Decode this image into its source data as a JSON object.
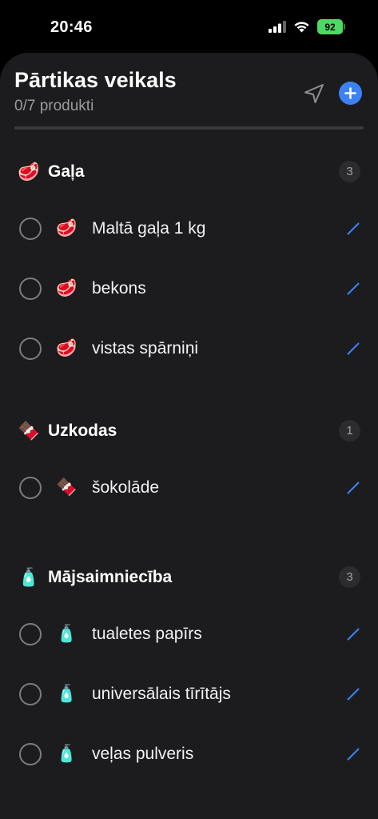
{
  "status_bar": {
    "time": "20:46",
    "battery": "92"
  },
  "header": {
    "title": "Pārtikas veikals",
    "subtitle": "0/7 produkti",
    "progress": 0,
    "accent_color": "#3b82f6"
  },
  "sections": [
    {
      "emoji": "🥩",
      "title": "Gaļa",
      "count": "3",
      "items": [
        {
          "emoji": "🥩",
          "name": "Maltā gaļa 1 kg",
          "checked": false
        },
        {
          "emoji": "🥩",
          "name": "bekons",
          "checked": false
        },
        {
          "emoji": "🥩",
          "name": "vistas spārniņi",
          "checked": false
        }
      ]
    },
    {
      "emoji": "🍫",
      "title": "Uzkodas",
      "count": "1",
      "items": [
        {
          "emoji": "🍫",
          "name": "šokolāde",
          "checked": false
        }
      ]
    },
    {
      "emoji": "🧴",
      "title": "Mājsaimniecība",
      "count": "3",
      "items": [
        {
          "emoji": "🧴",
          "name": "tualetes papīrs",
          "checked": false
        },
        {
          "emoji": "🧴",
          "name": "universālais tīrītājs",
          "checked": false
        },
        {
          "emoji": "🧴",
          "name": "veļas pulveris",
          "checked": false
        }
      ]
    }
  ]
}
